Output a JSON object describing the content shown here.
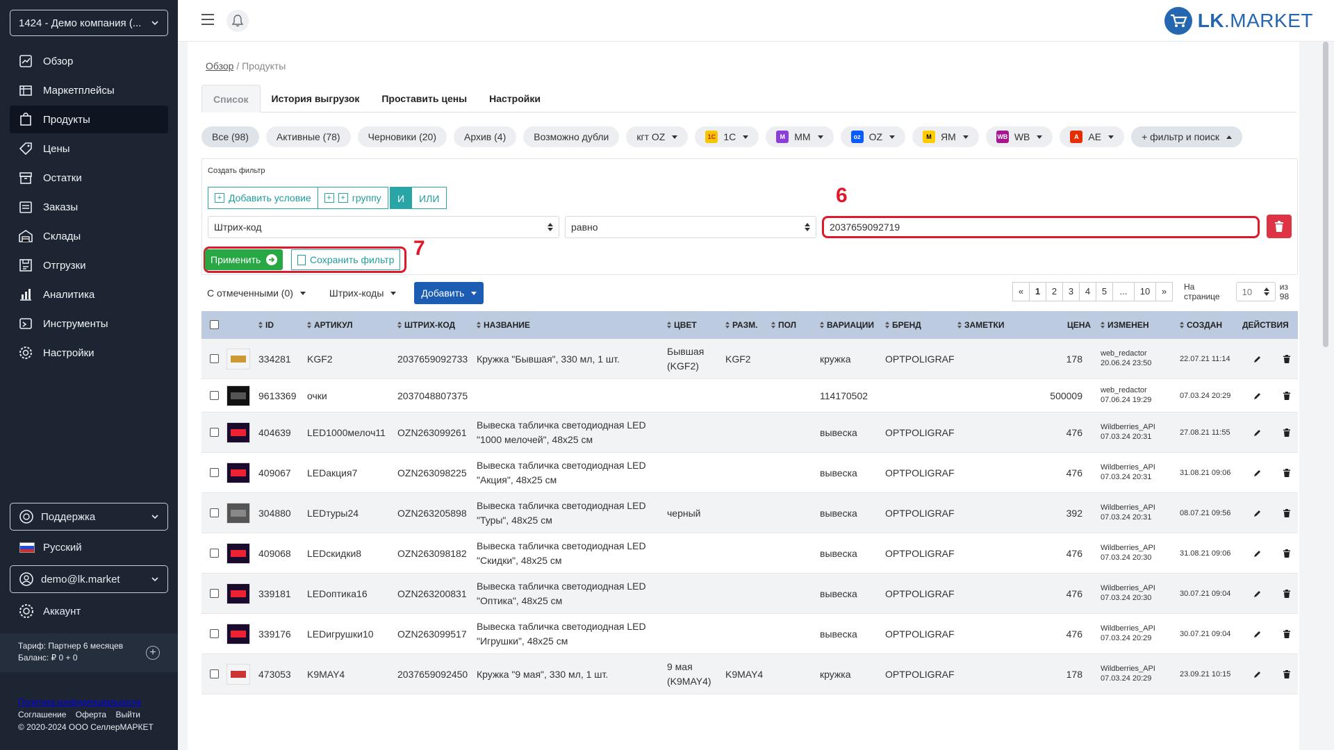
{
  "sidebar": {
    "company": "1424 - Демо компания (...",
    "nav": [
      {
        "label": "Обзор",
        "icon": "overview-icon"
      },
      {
        "label": "Маркетплейсы",
        "icon": "marketplaces-icon"
      },
      {
        "label": "Продукты",
        "icon": "products-icon",
        "active": true
      },
      {
        "label": "Цены",
        "icon": "price-tag-icon"
      },
      {
        "label": "Остатки",
        "icon": "stock-icon"
      },
      {
        "label": "Заказы",
        "icon": "orders-icon"
      },
      {
        "label": "Склады",
        "icon": "warehouse-icon"
      },
      {
        "label": "Отгрузки",
        "icon": "shipments-icon"
      },
      {
        "label": "Аналитика",
        "icon": "analytics-icon"
      },
      {
        "label": "Инструменты",
        "icon": "tools-icon"
      },
      {
        "label": "Настройки",
        "icon": "settings-icon"
      }
    ],
    "support": "Поддержка",
    "language": "Русский",
    "user": "demo@lk.market",
    "account": "Аккаунт",
    "tariff": "Тариф: Партнер 6 месяцев",
    "balance": "Баланс: ₽ 0 + 0",
    "links": {
      "privacy": "Политика конфиденциальности",
      "agreement": "Соглашение",
      "offer": "Оферта",
      "logout": "Выйти"
    },
    "copyright": "© 2020-2024 ООО СеллерМАРКЕТ"
  },
  "topbar": {
    "brand_bold": "LK",
    "brand_rest": ".MARKET"
  },
  "breadcrumb": {
    "root": "Обзор",
    "separator": "/",
    "current": "Продукты"
  },
  "tabs": [
    "Список",
    "История выгрузок",
    "Проставить цены",
    "Настройки"
  ],
  "chips": [
    {
      "label": "Все (98)"
    },
    {
      "label": "Активные (78)"
    },
    {
      "label": "Черновики (20)"
    },
    {
      "label": "Архив (4)"
    },
    {
      "label": "Возможно дубли"
    },
    {
      "label": "кгт OZ"
    },
    {
      "label": "1С"
    },
    {
      "label": "ММ"
    },
    {
      "label": "OZ"
    },
    {
      "label": "ЯМ"
    },
    {
      "label": "WB"
    },
    {
      "label": "AE"
    },
    {
      "label": "+ фильтр и поиск"
    }
  ],
  "filter": {
    "title": "Создать фильтр",
    "add_condition": "Добавить условие",
    "add_group": "группу",
    "and": "И",
    "or": "ИЛИ",
    "field": "Штрих-код",
    "operator": "равно",
    "value": "2037659092719",
    "apply": "Применить",
    "save": "Сохранить фильтр"
  },
  "annotations": {
    "value_marker": "6",
    "apply_marker": "7"
  },
  "toolbar": {
    "checked": "С отмеченными (0)",
    "barcodes": "Штрих-коды",
    "add": "Добавить"
  },
  "pager": {
    "prev": "«",
    "pages": [
      "1",
      "2",
      "3",
      "4",
      "5",
      "...",
      "10"
    ],
    "next": "»",
    "per_page_label": "На странице",
    "per_page_value": "10",
    "total": "из 98"
  },
  "columns": {
    "id": "ID",
    "sku": "АРТИКУЛ",
    "barcode": "ШТРИХ-КОД",
    "name": "НАЗВАНИЕ",
    "color": "ЦВЕТ",
    "size": "РАЗМ.",
    "gender": "ПОЛ",
    "variations": "ВАРИАЦИИ",
    "brand": "БРЕНД",
    "notes": "ЗАМЕТКИ",
    "price": "ЦЕНА",
    "changed": "ИЗМЕНЕН",
    "created": "СОЗДАН",
    "actions": "ДЕЙСТВИЯ"
  },
  "rows": [
    {
      "id": "334281",
      "sku": "KGF2",
      "barcode": "2037659092733",
      "name": "Кружка \"Бывшая\", 330 мл, 1 шт.",
      "color": "Бывшая (KGF2)",
      "size": "KGF2",
      "variations": "кружка",
      "brand": "OPTPOLIGRAF",
      "price": "178",
      "changed_by": "web_redactor",
      "changed_at": "20.06.24 23:50",
      "created": "22.07.21 11:14"
    },
    {
      "id": "9613369",
      "sku": "очки",
      "barcode": "2037048807375",
      "name": "",
      "color": "",
      "size": "",
      "variations": "114170502",
      "brand": "",
      "price": "500009",
      "changed_by": "web_redactor",
      "changed_at": "07.06.24 19:29",
      "created": "07.03.24 20:29"
    },
    {
      "id": "404639",
      "sku": "LED1000мелоч11",
      "barcode": "OZN263099261",
      "name": "Вывеска табличка светодиодная LED \"1000 мелочей\", 48х25 см",
      "color": "",
      "size": "",
      "variations": "вывеска",
      "brand": "OPTPOLIGRAF",
      "price": "476",
      "changed_by": "Wildberries_API",
      "changed_at": "07.03.24 20:31",
      "created": "27.08.21 11:55"
    },
    {
      "id": "409067",
      "sku": "LEDакция7",
      "barcode": "OZN263098225",
      "name": "Вывеска табличка светодиодная LED \"Акция\", 48х25 см",
      "color": "",
      "size": "",
      "variations": "вывеска",
      "brand": "OPTPOLIGRAF",
      "price": "476",
      "changed_by": "Wildberries_API",
      "changed_at": "07.03.24 20:31",
      "created": "31.08.21 09:06"
    },
    {
      "id": "304880",
      "sku": "LEDтуры24",
      "barcode": "OZN263205898",
      "name": "Вывеска табличка светодиодная LED \"Туры\", 48х25 см",
      "color": "черный",
      "size": "",
      "variations": "вывеска",
      "brand": "OPTPOLIGRAF",
      "price": "392",
      "changed_by": "Wildberries_API",
      "changed_at": "07.03.24 20:31",
      "created": "08.07.21 09:56"
    },
    {
      "id": "409068",
      "sku": "LEDскидки8",
      "barcode": "OZN263098182",
      "name": "Вывеска табличка светодиодная LED \"Скидки\", 48х25 см",
      "color": "",
      "size": "",
      "variations": "вывеска",
      "brand": "OPTPOLIGRAF",
      "price": "476",
      "changed_by": "Wildberries_API",
      "changed_at": "07.03.24 20:30",
      "created": "31.08.21 09:06"
    },
    {
      "id": "339181",
      "sku": "LEDоптика16",
      "barcode": "OZN263200831",
      "name": "Вывеска табличка светодиодная LED \"Оптика\", 48х25 см",
      "color": "",
      "size": "",
      "variations": "вывеска",
      "brand": "OPTPOLIGRAF",
      "price": "476",
      "changed_by": "Wildberries_API",
      "changed_at": "07.03.24 20:30",
      "created": "30.07.21 09:04"
    },
    {
      "id": "339176",
      "sku": "LEDигрушки10",
      "barcode": "OZN263099517",
      "name": "Вывеска табличка светодиодная LED \"Игрушки\", 48х25 см",
      "color": "",
      "size": "",
      "variations": "вывеска",
      "brand": "OPTPOLIGRAF",
      "price": "476",
      "changed_by": "Wildberries_API",
      "changed_at": "07.03.24 20:29",
      "created": "30.07.21 09:04"
    },
    {
      "id": "473053",
      "sku": "K9MAY4",
      "barcode": "2037659092450",
      "name": "Кружка \"9 мая\", 330 мл, 1 шт.",
      "color": "9 мая (K9MAY4)",
      "size": "K9MAY4",
      "variations": "кружка",
      "brand": "OPTPOLIGRAF",
      "price": "178",
      "changed_by": "Wildberries_API",
      "changed_at": "07.03.24 20:29",
      "created": "23.09.21 10:15"
    }
  ],
  "colors": {
    "sidebar": "#1d2532",
    "accent": "#2aa5a5",
    "apply": "#28a745",
    "primary": "#1c5db3",
    "danger": "#dd3344",
    "highlight": "#e0192a",
    "table_header": "#bccbe0"
  }
}
